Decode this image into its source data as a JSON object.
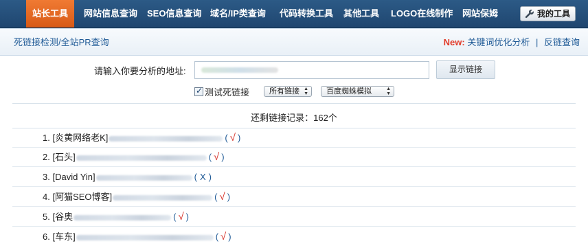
{
  "topnav": {
    "items": [
      {
        "label": "站长工具",
        "active": true
      },
      {
        "label": "网站信息查询"
      },
      {
        "label": "SEO信息查询"
      },
      {
        "label": "域名/IP类查询"
      },
      {
        "label": "代码转换工具"
      },
      {
        "label": "其他工具"
      },
      {
        "label": "LOGO在线制作"
      },
      {
        "label": "网站保姆"
      }
    ],
    "my_tools": "我的工具"
  },
  "subbar": {
    "left": "死链接检测/全站PR查询",
    "new_label": "New:",
    "links": [
      "关键词优化分析",
      "反链查询"
    ],
    "separator": "|"
  },
  "form": {
    "url_label": "请输入你要分析的地址:",
    "url_value": "",
    "submit": "显示链接",
    "checkbox_label": "测试死链接",
    "checkbox_checked": true,
    "link_filter": "所有链接",
    "spider": "百度蜘蛛模拟"
  },
  "summary": "还剩链接记录：162个",
  "results": [
    {
      "num": "1.",
      "name": "[炎黄网络老K]",
      "status": "√"
    },
    {
      "num": "2.",
      "name": "[石头]",
      "status": "√"
    },
    {
      "num": "3.",
      "name": "[David Yin]",
      "status": "X"
    },
    {
      "num": "4.",
      "name": "[阿猫SEO博客]",
      "status": "√"
    },
    {
      "num": "5.",
      "name": "[谷奥",
      "status": "√"
    },
    {
      "num": "6.",
      "name": "[车东]",
      "status": "√"
    }
  ],
  "status_paren_open": "(",
  "status_paren_close": ")",
  "colors": {
    "nav_bg": "#245079",
    "nav_active": "#e4661f",
    "link": "#1f5a96",
    "new": "#e23b2a",
    "ok_mark": "#d6332b"
  }
}
